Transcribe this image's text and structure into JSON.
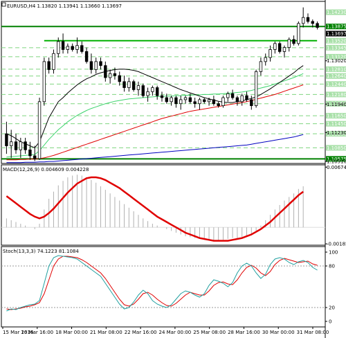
{
  "chart_data": {
    "type": "candlestick",
    "main": {
      "symbol": "EURUSD,H4",
      "header": "EURUSD,H4  1.13820 1.13941 1.13660 1.13697",
      "open": 1.1382,
      "high": 1.13941,
      "low": 1.1366,
      "close": 1.13697,
      "ylim": [
        1.1046,
        1.145
      ],
      "price_tags": [
        "1.14230",
        "1.13875",
        "1.13697",
        "1.13520",
        "1.13345",
        "1.13120",
        "1.12810",
        "1.12640",
        "1.12440",
        "1.12180",
        "1.11950",
        "1.11650",
        "1.11450",
        "1.11200",
        "1.10850",
        "1.10575"
      ],
      "price_tags_green": [
        "1.13875",
        "1.10575"
      ],
      "axis_ticks": [
        "1.13020",
        "1.11940",
        "1.11230",
        "1.10510"
      ],
      "hlines": [
        {
          "value": 1.13875,
          "color": "#008000",
          "full_width": true
        },
        {
          "value": 1.1352,
          "color": "#00b000",
          "full_width": false
        },
        {
          "value": 1.10575,
          "color": "#008000",
          "full_width": true
        }
      ],
      "dashed_levels": [
        1.13345,
        1.1312,
        1.1281,
        1.1264,
        1.1244,
        1.1218,
        1.1195,
        1.1165,
        1.1145,
        1.112,
        1.1085
      ],
      "candles": [
        [
          1.112,
          1.115,
          1.107,
          1.109
        ],
        [
          1.109,
          1.113,
          1.106,
          1.11
        ],
        [
          1.11,
          1.112,
          1.107,
          1.108
        ],
        [
          1.108,
          1.111,
          1.106,
          1.11
        ],
        [
          1.11,
          1.111,
          1.107,
          1.108
        ],
        [
          1.108,
          1.11,
          1.1055,
          1.1065
        ],
        [
          1.1065,
          1.109,
          1.1052,
          1.1058
        ],
        [
          1.1058,
          1.121,
          1.1055,
          1.12
        ],
        [
          1.12,
          1.131,
          1.119,
          1.13
        ],
        [
          1.13,
          1.131,
          1.127,
          1.128
        ],
        [
          1.128,
          1.133,
          1.127,
          1.132
        ],
        [
          1.132,
          1.136,
          1.131,
          1.135
        ],
        [
          1.135,
          1.137,
          1.132,
          1.133
        ],
        [
          1.133,
          1.1345,
          1.132,
          1.1338
        ],
        [
          1.1338,
          1.1345,
          1.1325,
          1.133
        ],
        [
          1.133,
          1.136,
          1.132,
          1.134
        ],
        [
          1.134,
          1.135,
          1.132,
          1.1325
        ],
        [
          1.1325,
          1.1335,
          1.1295,
          1.13
        ],
        [
          1.13,
          1.132,
          1.127,
          1.128
        ],
        [
          1.128,
          1.131,
          1.127,
          1.13
        ],
        [
          1.13,
          1.131,
          1.128,
          1.129
        ],
        [
          1.129,
          1.13,
          1.125,
          1.126
        ],
        [
          1.126,
          1.128,
          1.1245,
          1.127
        ],
        [
          1.127,
          1.1285,
          1.1255,
          1.1265
        ],
        [
          1.1265,
          1.1275,
          1.124,
          1.125
        ],
        [
          1.125,
          1.1265,
          1.1225,
          1.1235
        ],
        [
          1.1235,
          1.126,
          1.1225,
          1.125
        ],
        [
          1.125,
          1.1255,
          1.1225,
          1.123
        ],
        [
          1.123,
          1.125,
          1.1215,
          1.124
        ],
        [
          1.124,
          1.1245,
          1.121,
          1.1215
        ],
        [
          1.1215,
          1.1235,
          1.12,
          1.1225
        ],
        [
          1.1225,
          1.124,
          1.1215,
          1.1235
        ],
        [
          1.1235,
          1.124,
          1.1205,
          1.1215
        ],
        [
          1.1215,
          1.1225,
          1.12,
          1.121
        ],
        [
          1.121,
          1.122,
          1.1195,
          1.12
        ],
        [
          1.12,
          1.1215,
          1.119,
          1.121
        ],
        [
          1.121,
          1.1215,
          1.1185,
          1.1195
        ],
        [
          1.1195,
          1.1215,
          1.118,
          1.1205
        ],
        [
          1.1205,
          1.1215,
          1.1195,
          1.121
        ],
        [
          1.121,
          1.122,
          1.1195,
          1.12
        ],
        [
          1.12,
          1.121,
          1.1185,
          1.1195
        ],
        [
          1.1195,
          1.121,
          1.118,
          1.1205
        ],
        [
          1.1205,
          1.121,
          1.1195,
          1.12
        ],
        [
          1.12,
          1.121,
          1.119,
          1.1205
        ],
        [
          1.1205,
          1.1215,
          1.119,
          1.1195
        ],
        [
          1.1195,
          1.12,
          1.1185,
          1.119
        ],
        [
          1.119,
          1.1215,
          1.1185,
          1.121
        ],
        [
          1.121,
          1.1225,
          1.12,
          1.122
        ],
        [
          1.122,
          1.123,
          1.1205,
          1.121
        ],
        [
          1.121,
          1.1215,
          1.119,
          1.12
        ],
        [
          1.12,
          1.122,
          1.119,
          1.1215
        ],
        [
          1.1215,
          1.1225,
          1.12,
          1.1205
        ],
        [
          1.1205,
          1.1215,
          1.118,
          1.119
        ],
        [
          1.119,
          1.128,
          1.1185,
          1.1275
        ],
        [
          1.1275,
          1.131,
          1.1265,
          1.13
        ],
        [
          1.13,
          1.132,
          1.129,
          1.131
        ],
        [
          1.131,
          1.134,
          1.13,
          1.133
        ],
        [
          1.133,
          1.135,
          1.132,
          1.1345
        ],
        [
          1.1345,
          1.135,
          1.132,
          1.1325
        ],
        [
          1.1325,
          1.134,
          1.131,
          1.1335
        ],
        [
          1.1335,
          1.136,
          1.1325,
          1.1355
        ],
        [
          1.1355,
          1.1365,
          1.134,
          1.1345
        ],
        [
          1.1345,
          1.14,
          1.134,
          1.1395
        ],
        [
          1.1395,
          1.1435,
          1.1385,
          1.141
        ],
        [
          1.141,
          1.142,
          1.1395,
          1.14
        ],
        [
          1.14,
          1.1405,
          1.1385,
          1.1395
        ],
        [
          1.1395,
          1.14,
          1.138,
          1.1385
        ]
      ],
      "ma_black": [
        1.112,
        1.1115,
        1.1108,
        1.11,
        1.1095,
        1.109,
        1.1085,
        1.11,
        1.113,
        1.116,
        1.118,
        1.12,
        1.121,
        1.1222,
        1.1232,
        1.1242,
        1.125,
        1.1257,
        1.1262,
        1.1268,
        1.1272,
        1.1275,
        1.1278,
        1.128,
        1.1281,
        1.1281,
        1.128,
        1.1278,
        1.1275,
        1.127,
        1.1265,
        1.126,
        1.1255,
        1.125,
        1.1245,
        1.124,
        1.1235,
        1.123,
        1.1226,
        1.1222,
        1.1218,
        1.1214,
        1.121,
        1.1207,
        1.1204,
        1.1201,
        1.1199,
        1.1198,
        1.1198,
        1.12,
        1.1202,
        1.1205,
        1.1208,
        1.1212,
        1.1218,
        1.1225,
        1.1232,
        1.124,
        1.1248,
        1.1256,
        1.1264,
        1.1272,
        1.1282,
        1.129
      ],
      "ma_green": [
        1.1062,
        1.1063,
        1.1064,
        1.1065,
        1.1066,
        1.1067,
        1.1068,
        1.1078,
        1.1092,
        1.1106,
        1.1118,
        1.113,
        1.114,
        1.115,
        1.1158,
        1.1166,
        1.1172,
        1.1178,
        1.1183,
        1.1187,
        1.1191,
        1.1195,
        1.1198,
        1.1201,
        1.1203,
        1.1205,
        1.1207,
        1.1208,
        1.1209,
        1.121,
        1.1211,
        1.1212,
        1.1213,
        1.1213,
        1.1214,
        1.1214,
        1.1215,
        1.1215,
        1.1216,
        1.1216,
        1.1217,
        1.1217,
        1.1218,
        1.1218,
        1.1219,
        1.1219,
        1.122,
        1.1221,
        1.1222,
        1.1223,
        1.1224,
        1.1226,
        1.1228,
        1.1231,
        1.1234,
        1.1237,
        1.124,
        1.1244,
        1.1248,
        1.1252,
        1.1256,
        1.126,
        1.1265,
        1.127
      ],
      "ma_red": [
        1.1055,
        1.1055,
        1.1055,
        1.1056,
        1.1056,
        1.1057,
        1.1057,
        1.1058,
        1.106,
        1.1063,
        1.1066,
        1.107,
        1.1074,
        1.1078,
        1.1082,
        1.1086,
        1.109,
        1.1094,
        1.1098,
        1.1102,
        1.1106,
        1.111,
        1.1114,
        1.1118,
        1.1122,
        1.1126,
        1.113,
        1.1134,
        1.1138,
        1.1142,
        1.1146,
        1.115,
        1.1154,
        1.1158,
        1.1161,
        1.1164,
        1.1167,
        1.117,
        1.1173,
        1.1176,
        1.1178,
        1.118,
        1.1182,
        1.1184,
        1.1186,
        1.1188,
        1.119,
        1.1192,
        1.1194,
        1.1196,
        1.1198,
        1.12,
        1.1203,
        1.1206,
        1.1209,
        1.1212,
        1.1215,
        1.1218,
        1.1222,
        1.1226,
        1.123,
        1.1234,
        1.1238,
        1.1242
      ],
      "ma_blue": [
        1.1048,
        1.1048,
        1.1048,
        1.1048,
        1.1049,
        1.1049,
        1.1049,
        1.105,
        1.105,
        1.1051,
        1.1051,
        1.1052,
        1.1053,
        1.1054,
        1.1055,
        1.1056,
        1.1057,
        1.1058,
        1.1059,
        1.106,
        1.1061,
        1.1062,
        1.1063,
        1.1064,
        1.1065,
        1.1066,
        1.1067,
        1.1068,
        1.1069,
        1.107,
        1.1071,
        1.1072,
        1.1073,
        1.1074,
        1.1075,
        1.1076,
        1.1077,
        1.1078,
        1.1079,
        1.108,
        1.1081,
        1.1082,
        1.1083,
        1.1084,
        1.1085,
        1.1086,
        1.1087,
        1.1088,
        1.1089,
        1.109,
        1.1091,
        1.1092,
        1.1094,
        1.1096,
        1.1098,
        1.11,
        1.1102,
        1.1104,
        1.1106,
        1.1108,
        1.111,
        1.1112,
        1.1115,
        1.1118
      ]
    },
    "macd": {
      "header": "MACD(12,26,9) 0.004609 0.004228",
      "ylim": [
        -0.002,
        0.007
      ],
      "axis_ticks": [
        "0.006745",
        "-0.00185"
      ],
      "tick_values": [
        0.006745,
        -0.00185
      ],
      "histogram": [
        0.001,
        0.0008,
        0.0006,
        0.0004,
        0.0002,
        0.0,
        -0.0002,
        0.0004,
        0.002,
        0.0032,
        0.004,
        0.0047,
        0.0052,
        0.0056,
        0.0058,
        0.0059,
        0.0058,
        0.0056,
        0.0053,
        0.005,
        0.0046,
        0.0042,
        0.0038,
        0.0034,
        0.003,
        0.0026,
        0.0022,
        0.0018,
        0.0014,
        0.001,
        0.0007,
        0.0004,
        0.0002,
        0.0,
        -0.0002,
        -0.0004,
        -0.0006,
        -0.0008,
        -0.001,
        -0.0011,
        -0.0012,
        -0.0013,
        -0.0014,
        -0.0014,
        -0.0015,
        -0.0015,
        -0.0014,
        -0.0013,
        -0.0012,
        -0.0012,
        -0.0011,
        -0.001,
        -0.0009,
        -0.0004,
        0.0002,
        0.0008,
        0.0014,
        0.002,
        0.0025,
        0.003,
        0.0034,
        0.0038,
        0.0043,
        0.0046
      ],
      "signal": [
        0.0035,
        0.0031,
        0.0027,
        0.0023,
        0.0019,
        0.0015,
        0.0012,
        0.001,
        0.0012,
        0.0016,
        0.0021,
        0.0027,
        0.0033,
        0.0039,
        0.0044,
        0.0049,
        0.0052,
        0.0055,
        0.0056,
        0.0056,
        0.0055,
        0.0053,
        0.005,
        0.0047,
        0.0044,
        0.004,
        0.0036,
        0.0032,
        0.0028,
        0.0024,
        0.002,
        0.0016,
        0.0012,
        0.0009,
        0.0006,
        0.0003,
        0.0,
        -0.0003,
        -0.0006,
        -0.0008,
        -0.001,
        -0.0012,
        -0.0013,
        -0.0014,
        -0.0015,
        -0.0015,
        -0.0015,
        -0.0015,
        -0.0014,
        -0.0013,
        -0.0012,
        -0.001,
        -0.0008,
        -0.0005,
        -0.0002,
        0.0002,
        0.0006,
        0.0011,
        0.0016,
        0.0021,
        0.0026,
        0.0031,
        0.0036,
        0.004
      ]
    },
    "stoch": {
      "header": "Stoch(13,3,3) 74.1223 81.1084",
      "ylim": [
        0,
        100
      ],
      "levels": [
        20,
        80
      ],
      "axis_ticks": [
        "100",
        "80",
        "20",
        "0"
      ],
      "tick_values": [
        100,
        80,
        20,
        0
      ],
      "k": [
        15,
        18,
        17,
        20,
        22,
        24,
        25,
        30,
        55,
        80,
        92,
        95,
        94,
        93,
        92,
        90,
        85,
        80,
        75,
        70,
        65,
        55,
        45,
        35,
        25,
        18,
        20,
        28,
        38,
        45,
        40,
        30,
        25,
        22,
        20,
        24,
        32,
        40,
        44,
        42,
        38,
        35,
        40,
        52,
        60,
        58,
        55,
        50,
        56,
        70,
        80,
        84,
        80,
        70,
        62,
        68,
        82,
        90,
        92,
        90,
        85,
        82,
        86,
        88,
        85,
        78,
        74
      ],
      "d": [
        18,
        17,
        18,
        19,
        21,
        22,
        24,
        27,
        40,
        60,
        80,
        90,
        94,
        94,
        93,
        92,
        89,
        85,
        80,
        75,
        70,
        62,
        52,
        42,
        32,
        24,
        22,
        25,
        32,
        40,
        42,
        38,
        32,
        27,
        23,
        22,
        26,
        32,
        38,
        42,
        40,
        38,
        38,
        44,
        52,
        56,
        57,
        54,
        53,
        60,
        70,
        78,
        81,
        77,
        70,
        66,
        72,
        82,
        88,
        91,
        89,
        87,
        85,
        86,
        87,
        83,
        81
      ]
    },
    "x_ticks": [
      "15 Mar 2016",
      "16 Mar 16:00",
      "18 Mar 00:00",
      "21 Mar 08:00",
      "22 Mar 16:00",
      "24 Mar 00:00",
      "25 Mar 08:00",
      "28 Mar 16:00",
      "30 Mar 00:00",
      "31 Mar 08:00"
    ]
  },
  "colors": {
    "bull": "#ffffff",
    "bear": "#000000",
    "wick": "#000000",
    "ma_black": "#000000",
    "ma_green": "#3cd46c",
    "ma_red": "#e00000",
    "ma_blue": "#0000c0",
    "level_green": "#008000",
    "level_dash": "#7fd57f",
    "macd_hist": "#b0b0b0",
    "macd_signal": "#e00000",
    "stoch_k": "#20a0a0",
    "stoch_d": "#e00000",
    "tag_green": "#008000",
    "tag_pale": "#a8e0a8",
    "tag_dark": "#000000"
  }
}
